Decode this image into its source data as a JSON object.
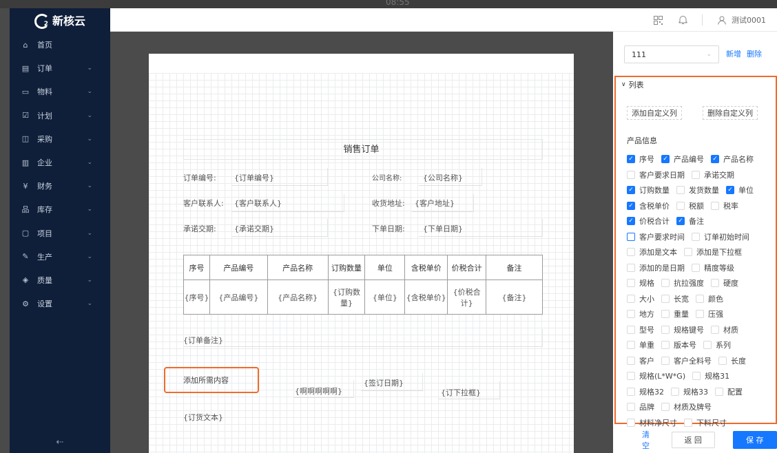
{
  "top": {
    "clock": "08:55"
  },
  "app": {
    "name": "新核云",
    "logo_sub": "2"
  },
  "sidebar": {
    "items": [
      {
        "label": "首页",
        "icon": "home-icon",
        "glyph": "⌂",
        "chev": ""
      },
      {
        "label": "订单",
        "icon": "order-icon",
        "glyph": "▤",
        "chev": "⌄"
      },
      {
        "label": "物料",
        "icon": "material-icon",
        "glyph": "▭",
        "chev": "⌄"
      },
      {
        "label": "计划",
        "icon": "plan-icon",
        "glyph": "☑",
        "chev": "⌄"
      },
      {
        "label": "采购",
        "icon": "purchase-icon",
        "glyph": "◫",
        "chev": "⌄"
      },
      {
        "label": "企业",
        "icon": "enterprise-icon",
        "glyph": "▥",
        "chev": "⌄"
      },
      {
        "label": "财务",
        "icon": "finance-icon",
        "glyph": "¥",
        "chev": "⌄"
      },
      {
        "label": "库存",
        "icon": "inventory-icon",
        "glyph": "品",
        "chev": "⌄"
      },
      {
        "label": "项目",
        "icon": "project-icon",
        "glyph": "▢",
        "chev": "⌄"
      },
      {
        "label": "生产",
        "icon": "production-icon",
        "glyph": "✎",
        "chev": "⌄"
      },
      {
        "label": "质量",
        "icon": "quality-icon",
        "glyph": "◈",
        "chev": "⌄"
      },
      {
        "label": "设置",
        "icon": "settings-icon",
        "glyph": "⚙",
        "chev": "⌄"
      }
    ],
    "collapse_glyph": "⇠"
  },
  "header": {
    "user": "测试0001"
  },
  "doc": {
    "title": "销售订单",
    "fields": {
      "order_no_label": "订单编号:",
      "order_no_value": "{订单编号}",
      "company_label": "公司名称:",
      "company_value": "{公司名称}",
      "contact_label": "客户联系人:",
      "contact_value": "{客户联系人}",
      "address_label": "收货地址:",
      "address_value": "{客户地址}",
      "promise_label": "承诺交期:",
      "promise_value": "{承诺交期}",
      "order_date_label": "下单日期:",
      "order_date_value": "{下单日期}"
    },
    "table": {
      "headers": [
        "序号",
        "产品编号",
        "产品名称",
        "订购数量",
        "单位",
        "含税单价",
        "价税合计",
        "备注"
      ],
      "row": [
        "{序号}",
        "{产品编号}",
        "{产品名称}",
        "{订购数量}",
        "{单位}",
        "{含税单价}",
        "{价税合计}",
        "{备注}"
      ]
    },
    "order_note": "{订单备注}",
    "add_content": "添加所需内容",
    "aaa": "{啊啊啊啊啊}",
    "sign_date": "{签订日期}",
    "dropdown": "{订下拉框}",
    "order_text": "{订货文本}"
  },
  "panel": {
    "select_value": "111",
    "add_label": "新增",
    "delete_label": "删除",
    "section_title": "列表",
    "add_custom": "添加自定义列",
    "delete_custom": "删除自定义列",
    "group_title": "产品信息",
    "rows": [
      [
        {
          "label": "序号",
          "on": true
        },
        {
          "label": "产品编号",
          "on": true
        },
        {
          "label": "产品名称",
          "on": true
        }
      ],
      [
        {
          "label": "客户要求日期",
          "on": false
        },
        {
          "label": "承诺交期",
          "on": false
        }
      ],
      [
        {
          "label": "订购数量",
          "on": true
        },
        {
          "label": "发货数量",
          "on": false
        },
        {
          "label": "单位",
          "on": true
        }
      ],
      [
        {
          "label": "含税单价",
          "on": true
        },
        {
          "label": "税额",
          "on": false
        },
        {
          "label": "税率",
          "on": false
        }
      ],
      [
        {
          "label": "价税合计",
          "on": true
        },
        {
          "label": "备注",
          "on": true
        }
      ],
      [
        {
          "label": "客户要求时间",
          "on": false,
          "hover": true
        },
        {
          "label": "订单初始时间",
          "on": false
        }
      ],
      [
        {
          "label": "添加是文本",
          "on": false
        },
        {
          "label": "添加是下拉框",
          "on": false
        }
      ],
      [
        {
          "label": "添加的是日期",
          "on": false
        },
        {
          "label": "精度等级",
          "on": false
        }
      ],
      [
        {
          "label": "规格",
          "on": false
        },
        {
          "label": "抗拉强度",
          "on": false
        },
        {
          "label": "硬度",
          "on": false
        }
      ],
      [
        {
          "label": "大小",
          "on": false
        },
        {
          "label": "长宽",
          "on": false
        },
        {
          "label": "颜色",
          "on": false
        }
      ],
      [
        {
          "label": "地方",
          "on": false
        },
        {
          "label": "重量",
          "on": false
        },
        {
          "label": "压强",
          "on": false
        }
      ],
      [
        {
          "label": "型号",
          "on": false
        },
        {
          "label": "规格键号",
          "on": false
        },
        {
          "label": "材质",
          "on": false
        }
      ],
      [
        {
          "label": "单重",
          "on": false
        },
        {
          "label": "版本号",
          "on": false
        },
        {
          "label": "系列",
          "on": false
        }
      ],
      [
        {
          "label": "客户",
          "on": false
        },
        {
          "label": "客户全料号",
          "on": false
        },
        {
          "label": "长度",
          "on": false
        }
      ],
      [
        {
          "label": "规格(L*W*G)",
          "on": false
        },
        {
          "label": "规格31",
          "on": false
        }
      ],
      [
        {
          "label": "规格32",
          "on": false
        },
        {
          "label": "规格33",
          "on": false
        },
        {
          "label": "配置",
          "on": false
        }
      ],
      [
        {
          "label": "品牌",
          "on": false
        },
        {
          "label": "材质及牌号",
          "on": false
        }
      ],
      [
        {
          "label": "材料净尺寸",
          "on": false
        },
        {
          "label": "下料尺寸",
          "on": false
        }
      ]
    ],
    "clear_label": "清空",
    "back_label": "返 回",
    "save_label": "保 存"
  }
}
